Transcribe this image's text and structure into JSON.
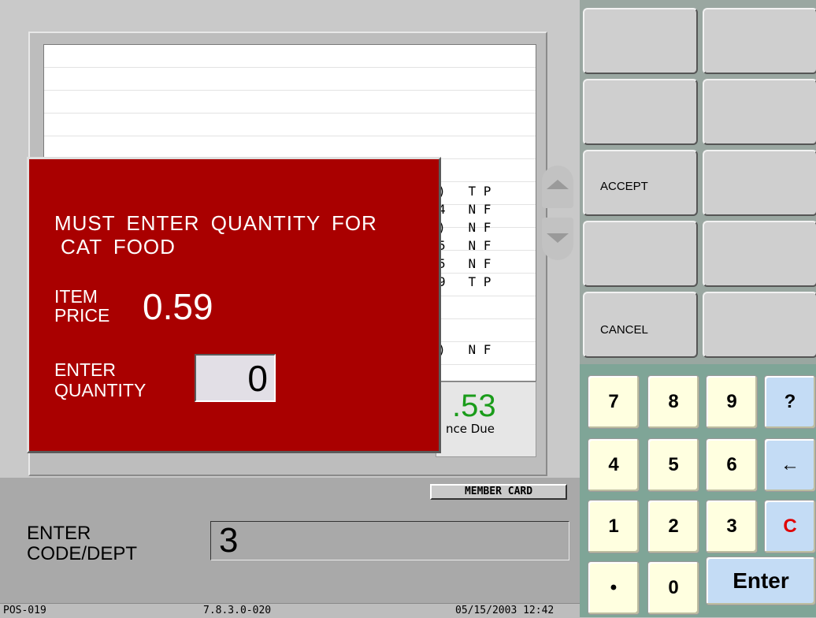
{
  "receipt": {
    "rows": [
      {
        "text": ")   T P"
      },
      {
        "text": "4   N F"
      },
      {
        "text": ")   N F"
      },
      {
        "text": "5   N F"
      },
      {
        "text": "5   N F"
      },
      {
        "text": "9   T P"
      },
      {
        "text": ")   N F"
      }
    ],
    "total_amount": ".53",
    "total_label": "nce Due"
  },
  "dialog": {
    "message_line1": "MUST ENTER QUANTITY FOR",
    "message_line2": "CAT FOOD",
    "item_label": "ITEM\nPRICE",
    "item_price": "0.59",
    "quantity_label": "ENTER\nQUANTITY",
    "quantity_value": "0",
    "background": "#a90000"
  },
  "bottom": {
    "member_card_label": "MEMBER CARD",
    "entry_label": "ENTER\nCODE/DEPT",
    "entry_value": "3"
  },
  "status_bar": {
    "terminal": "POS-019",
    "version": "7.8.3.0-020",
    "datetime": "05/15/2003 12:42"
  },
  "function_keys": [
    {
      "label": ""
    },
    {
      "label": ""
    },
    {
      "label": ""
    },
    {
      "label": ""
    },
    {
      "label": "ACCEPT"
    },
    {
      "label": ""
    },
    {
      "label": ""
    },
    {
      "label": ""
    },
    {
      "label": "CANCEL"
    },
    {
      "label": ""
    }
  ],
  "keypad": {
    "k7": "7",
    "k8": "8",
    "k9": "9",
    "help": "?",
    "k4": "4",
    "k5": "5",
    "k6": "6",
    "backspace": "←",
    "k1": "1",
    "k2": "2",
    "k3": "3",
    "clear": "C",
    "dot": "•",
    "k0": "0",
    "enter": "Enter"
  }
}
